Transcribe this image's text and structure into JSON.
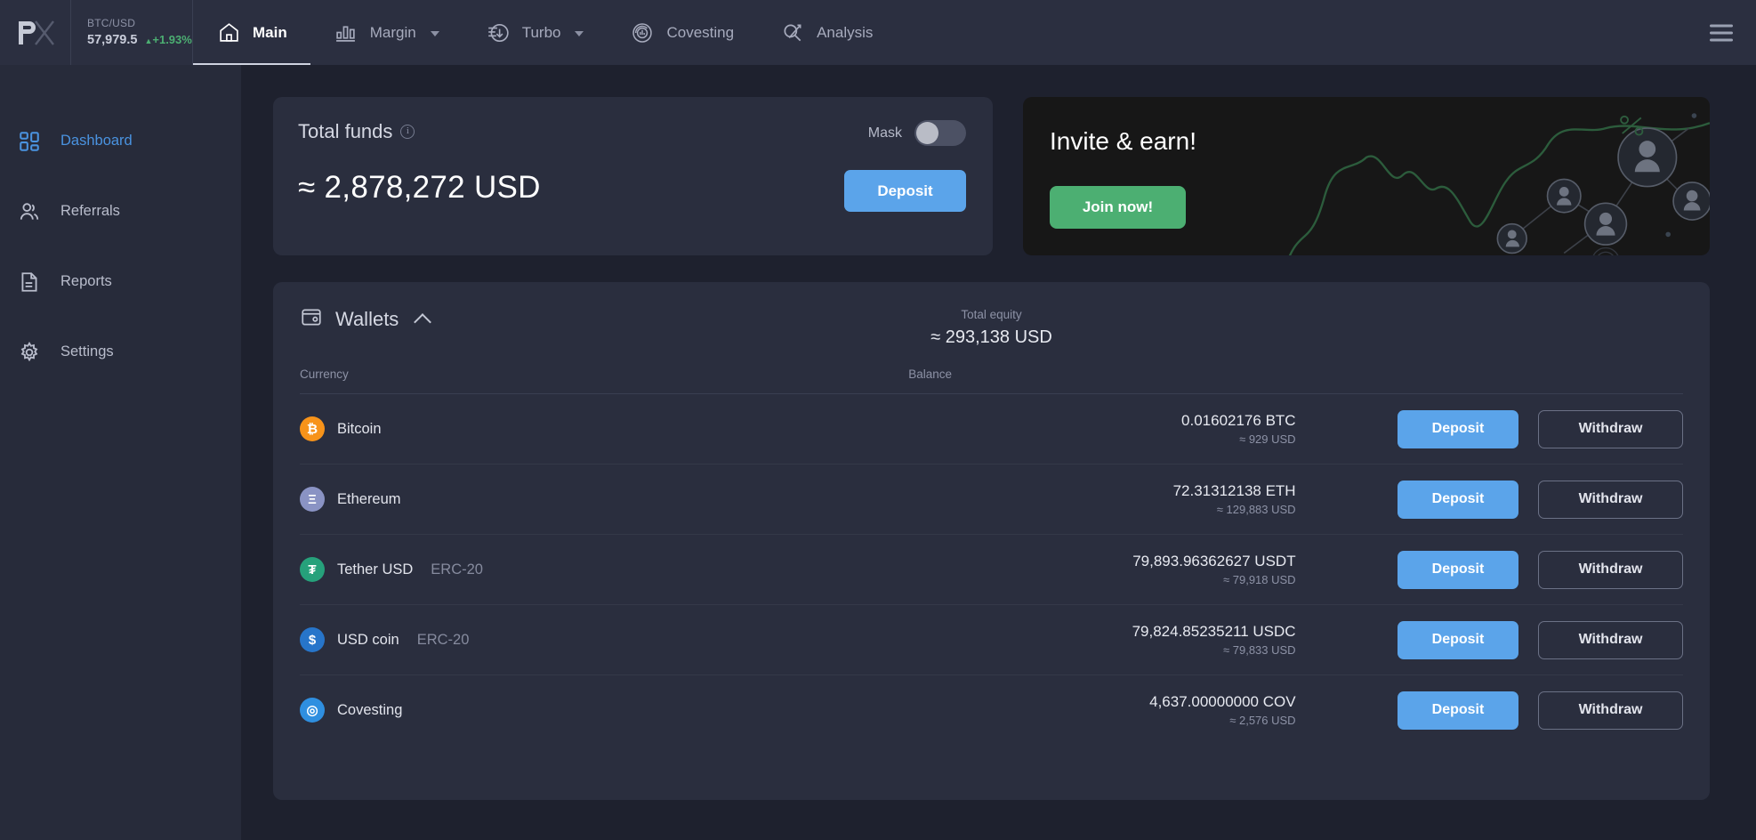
{
  "topbar": {
    "logo": "px-logo",
    "ticker": {
      "pair": "BTC/USD",
      "price": "57,979.5",
      "change": "+1.93%"
    },
    "tabs": [
      {
        "label": "Main",
        "icon": "home-icon",
        "active": true,
        "dropdown": false
      },
      {
        "label": "Margin",
        "icon": "bar-chart-icon",
        "active": false,
        "dropdown": true
      },
      {
        "label": "Turbo",
        "icon": "turbo-icon",
        "active": false,
        "dropdown": true
      },
      {
        "label": "Covesting",
        "icon": "covesting-icon",
        "active": false,
        "dropdown": false
      },
      {
        "label": "Analysis",
        "icon": "analysis-icon",
        "active": false,
        "dropdown": false
      }
    ],
    "menu_icon": "hamburger-icon"
  },
  "sidebar": {
    "items": [
      {
        "label": "Dashboard",
        "icon": "dashboard-icon",
        "active": true
      },
      {
        "label": "Referrals",
        "icon": "users-icon",
        "active": false
      },
      {
        "label": "Reports",
        "icon": "document-icon",
        "active": false
      },
      {
        "label": "Settings",
        "icon": "gear-icon",
        "active": false
      }
    ]
  },
  "total_funds": {
    "title": "Total funds",
    "info_icon": "info-icon",
    "amount": "≈ 2,878,272 USD",
    "mask_label": "Mask",
    "mask_on": false,
    "deposit_label": "Deposit"
  },
  "invite": {
    "title": "Invite & earn!",
    "cta_label": "Join now!",
    "accent_color": "#4caf72",
    "background_color": "#171717"
  },
  "wallets": {
    "title": "Wallets",
    "collapse_icon": "chevron-up-icon",
    "equity_label": "Total equity",
    "equity_value": "≈ 293,138 USD",
    "columns": {
      "currency": "Currency",
      "balance": "Balance"
    },
    "deposit_label": "Deposit",
    "withdraw_label": "Withdraw",
    "rows": [
      {
        "name": "Bitcoin",
        "network": "",
        "icon": "bitcoin-icon",
        "color": "#f7931a",
        "symbol_glyph": "₿",
        "balance": "0.01602176 BTC",
        "usd": "≈ 929 USD"
      },
      {
        "name": "Ethereum",
        "network": "",
        "icon": "ethereum-icon",
        "color": "#8a93c4",
        "symbol_glyph": "Ξ",
        "balance": "72.31312138 ETH",
        "usd": "≈ 129,883 USD"
      },
      {
        "name": "Tether USD",
        "network": "ERC-20",
        "icon": "tether-icon",
        "color": "#26a17b",
        "symbol_glyph": "₮",
        "balance": "79,893.96362627 USDT",
        "usd": "≈ 79,918 USD"
      },
      {
        "name": "USD coin",
        "network": "ERC-20",
        "icon": "usdc-icon",
        "color": "#2775ca",
        "symbol_glyph": "$",
        "balance": "79,824.85235211 USDC",
        "usd": "≈ 79,833 USD"
      },
      {
        "name": "Covesting",
        "network": "",
        "icon": "covesting-coin-icon",
        "color": "#2f8fe0",
        "symbol_glyph": "◎",
        "balance": "4,637.00000000 COV",
        "usd": "≈ 2,576 USD"
      }
    ]
  },
  "colors": {
    "accent_blue": "#5ba4ea",
    "sidebar_active": "#4a93e0",
    "positive_green": "#4caf72",
    "page_bg": "#1e212e",
    "card_bg": "#2a2e3e",
    "topbar_bg": "#2b2f40"
  }
}
